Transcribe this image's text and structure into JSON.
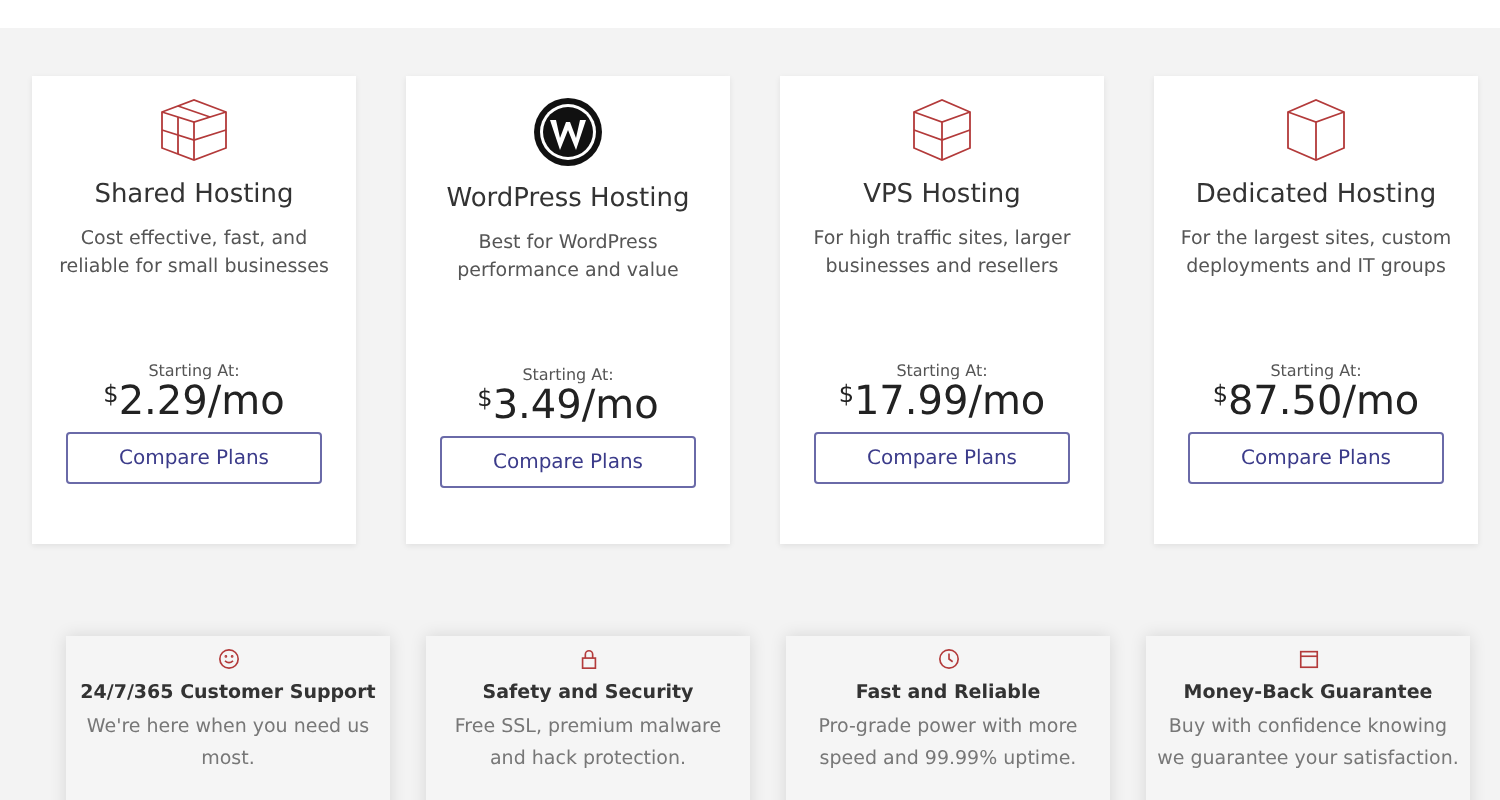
{
  "plans": [
    {
      "kind": "cube-grid",
      "title": "Shared Hosting",
      "description": "Cost effective, fast, and reliable for small businesses",
      "starting_label": "Starting At:",
      "currency": "$",
      "price": "2.29/mo",
      "button": "Compare Plans"
    },
    {
      "kind": "wordpress",
      "title": "WordPress Hosting",
      "description": "Best for WordPress performance and value",
      "starting_label": "Starting At:",
      "currency": "$",
      "price": "3.49/mo",
      "button": "Compare Plans"
    },
    {
      "kind": "box-split",
      "title": "VPS Hosting",
      "description": "For high traffic sites, larger businesses and resellers",
      "starting_label": "Starting At:",
      "currency": "$",
      "price": "17.99/mo",
      "button": "Compare Plans"
    },
    {
      "kind": "box",
      "title": "Dedicated Hosting",
      "description": "For the largest sites, custom deployments and IT groups",
      "starting_label": "Starting At:",
      "currency": "$",
      "price": "87.50/mo",
      "button": "Compare Plans"
    }
  ],
  "features": [
    {
      "kind": "smile",
      "title": "24/7/365 Customer Support",
      "description": "We're here when you need us most."
    },
    {
      "kind": "lock",
      "title": "Safety and Security",
      "description": "Free SSL, premium malware and hack protection."
    },
    {
      "kind": "clock",
      "title": "Fast and Reliable",
      "description": "Pro-grade power with more speed and 99.99% uptime."
    },
    {
      "kind": "calendar",
      "title": "Money-Back Guarantee",
      "description": "Buy with confidence knowing we guarantee your satisfaction."
    }
  ]
}
